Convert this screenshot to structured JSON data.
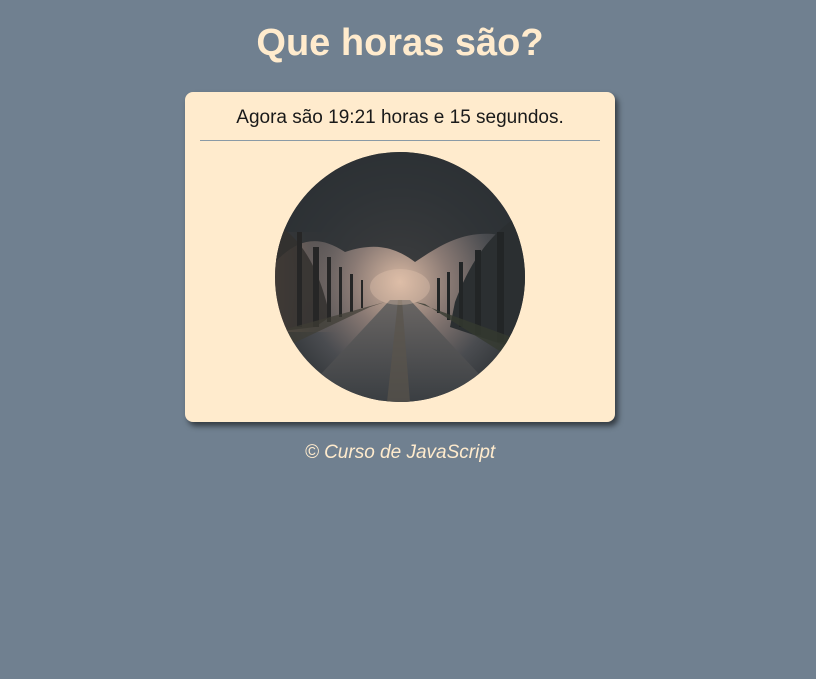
{
  "header": {
    "title": "Que horas são?"
  },
  "clock": {
    "message": "Agora são 19:21 horas e 15 segundos."
  },
  "photo": {
    "icon": "evening-tree-lined-path-photo"
  },
  "footer": {
    "text": "© Curso de JavaScript"
  },
  "colors": {
    "background": "#708090",
    "card": "#ffebcd",
    "title": "#ffebcd"
  }
}
